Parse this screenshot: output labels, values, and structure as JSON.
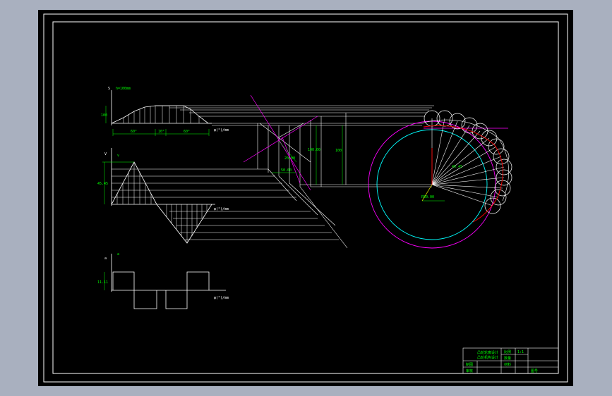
{
  "colors": {
    "background": "#a9b0bf",
    "canvas": "#000000",
    "frame": "#ffffff",
    "geometry": "#ffffff",
    "dimension": "#00ff00",
    "construction": "#ff00ff",
    "base_circle": "#00ffff",
    "roller": "#ff0000",
    "marker": "#ffff00"
  },
  "diagram": {
    "displacement": {
      "axis_label": "S",
      "y_label": "h=100mm",
      "x_label": "φ(°)/mm",
      "height_label": "100",
      "segments": [
        "60°",
        "10°",
        "60°"
      ]
    },
    "velocity": {
      "axis_label": "V",
      "y_label": "v",
      "x_label": "φ(°)/mm",
      "peak_label": "45.45"
    },
    "acceleration": {
      "axis_label": "a",
      "y_label": "a",
      "x_label": "φ(°)/mm",
      "peak_label": "11.11"
    },
    "cam": {
      "radius_label": "R50.00",
      "dim_a": "50.00",
      "dim_b": "20.00",
      "dim_c": "100.00",
      "dim_d": "45.45",
      "dim_e": "100"
    }
  },
  "title_block": {
    "title_line1": "凸轮轮廓设计",
    "title_line2": "凸轮机构设计",
    "scale_label": "比例",
    "scale_value": "1:1",
    "qty_label": "数量",
    "material_label": "材料",
    "drawn_label": "制图",
    "checked_label": "审核",
    "drawing_no": "图号"
  }
}
